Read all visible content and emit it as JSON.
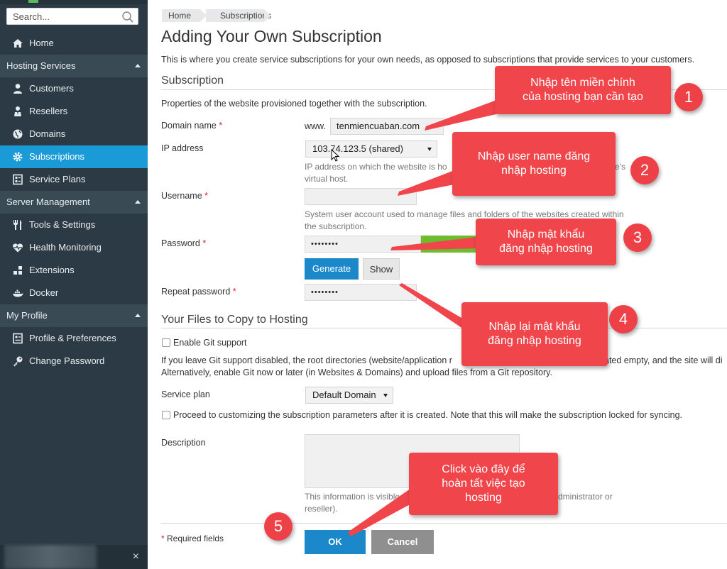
{
  "sidebar": {
    "search_placeholder": "Search...",
    "home": "Home",
    "hosting_services": {
      "label": "Hosting Services",
      "items": [
        "Customers",
        "Resellers",
        "Domains",
        "Subscriptions",
        "Service Plans"
      ]
    },
    "server_management": {
      "label": "Server Management",
      "items": [
        "Tools & Settings",
        "Health Monitoring",
        "Extensions",
        "Docker"
      ]
    },
    "my_profile": {
      "label": "My Profile",
      "items": [
        "Profile & Preferences",
        "Change Password"
      ]
    },
    "active_item": "Subscriptions",
    "close_glyph": "×"
  },
  "breadcrumb": [
    "Home",
    "Subscriptions"
  ],
  "page": {
    "title": "Adding Your Own Subscription",
    "intro": "This is where you create service subscriptions for your own needs, as opposed to subscriptions that provide services to your customers."
  },
  "subscription": {
    "heading": "Subscription",
    "description": "Properties of the website provisioned together with the subscription.",
    "domain_label": "Domain name",
    "domain_prefix": "www.",
    "domain_value": "tenmiencuaban.com",
    "ip_label": "IP address",
    "ip_value": "103.74.123.5 (shared)",
    "ip_hint_a": "IP address on which the website is ho",
    "ip_hint_b": "e's",
    "ip_hint_c": "virtual host.",
    "username_label": "Username",
    "username_value": "",
    "username_hint": "System user account used to manage files and folders of the websites created within the subscription.",
    "password_label": "Password",
    "password_value": "••••••••",
    "generate_label": "Generate",
    "show_label": "Show",
    "repeat_label": "Repeat password",
    "repeat_value": "••••••••",
    "required_mark": "*"
  },
  "files": {
    "heading": "Your Files to Copy to Hosting",
    "git_label": "Enable Git support",
    "git_checked": false,
    "git_note_1a": "If you leave Git support disabled, the root directories (website/application r",
    "git_note_1b": "ated empty, and the site will di",
    "git_note_2": "Alternatively, enable Git now or later (in Websites & Domains) and upload files from a Git repository."
  },
  "plan": {
    "label": "Service plan",
    "value": "Default Domain",
    "proceed_label": "Proceed to customizing the subscription parameters after it is created. Note that this will make the subscription locked for syncing.",
    "proceed_checked": false
  },
  "description": {
    "label": "Description",
    "value": "",
    "hint_a": "This information is visible",
    "hint_b": "dministrator or",
    "hint_c": "reseller)."
  },
  "footer": {
    "required_note": "Required fields",
    "required_mark": "*",
    "ok_label": "OK",
    "cancel_label": "Cancel"
  },
  "annotations": [
    {
      "number": "1",
      "text_1": "Nhập tên miền chính",
      "text_2": "của hosting bạn cần tạo"
    },
    {
      "number": "2",
      "text_1": "Nhập user name đăng",
      "text_2": "nhập hosting"
    },
    {
      "number": "3",
      "text_1": "Nhập mật khẩu",
      "text_2": "đăng nhập hosting"
    },
    {
      "number": "4",
      "text_1": "Nhập lại mật khẩu",
      "text_2": "đăng nhập hosting"
    },
    {
      "number": "5",
      "text_1": "Click vào đây để",
      "text_2": "hoàn tất việc tạo",
      "text_3": "hosting"
    }
  ],
  "colors": {
    "sidebar_bg": "#2b3a44",
    "active_item": "#1a9ad6",
    "primary_button": "#1a88c9",
    "callout_red": "#f0454b",
    "password_strength": "#6dbb2f"
  }
}
